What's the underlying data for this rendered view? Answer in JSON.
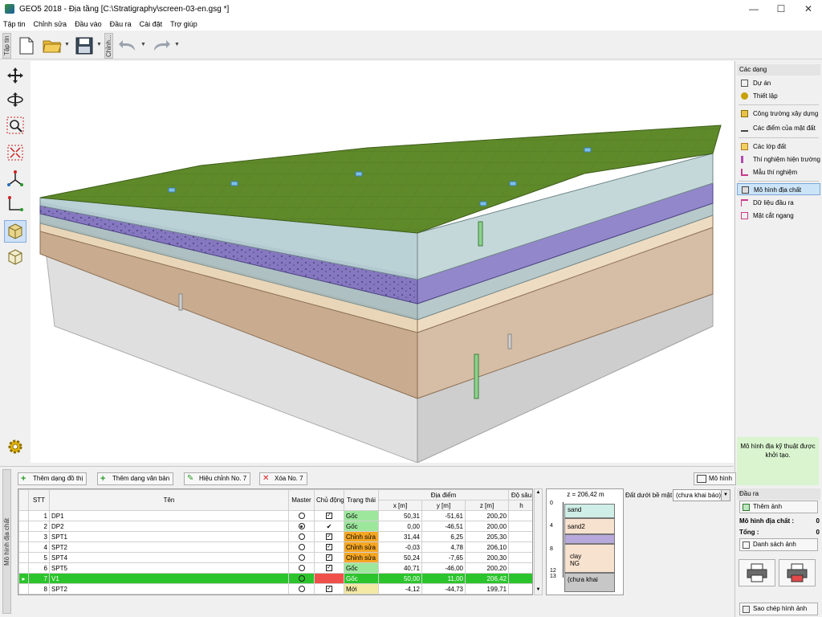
{
  "window": {
    "title": "GEO5 2018 - Địa tầng [C:\\Stratigraphy\\screen-03-en.gsg *]",
    "minimize": "—",
    "maximize": "☐",
    "close": "✕"
  },
  "menu": [
    "Tập tin",
    "Chỉnh sửa",
    "Đầu vào",
    "Đầu ra",
    "Cài đặt",
    "Trợ giúp"
  ],
  "toolbar": {
    "file_tab": "Tập tin",
    "edit_tab": "Chỉnh..."
  },
  "right_panel": {
    "header": "Các dạng",
    "items": [
      {
        "label": "Dự án",
        "icon": "project-icon",
        "color": "#555555"
      },
      {
        "label": "Thiết lập",
        "icon": "settings-gear-icon",
        "color": "#c8a000"
      },
      {
        "label": "Công trường xây dựng",
        "icon": "construction-site-icon",
        "color": "#8a6d00"
      },
      {
        "label": "Các điểm của mặt đất",
        "icon": "terrain-points-icon",
        "color": "#444444"
      },
      {
        "label": "Các lớp đất",
        "icon": "soil-layers-icon",
        "color": "#b07b1c"
      },
      {
        "label": "Thí nghiệm hiện trường",
        "icon": "field-test-icon",
        "color": "#b04cb0"
      },
      {
        "label": "Mẫu thí nghiệm",
        "icon": "lab-sample-icon",
        "color": "#cc3a8a"
      },
      {
        "label": "Mô hình địa chất",
        "icon": "geological-model-icon",
        "color": "#444444"
      },
      {
        "label": "Dữ liệu đầu ra",
        "icon": "output-data-icon",
        "color": "#cc3a8a"
      },
      {
        "label": "Mặt cắt ngang",
        "icon": "cross-section-icon",
        "color": "#cc3a8a"
      }
    ],
    "status_message": "Mô hình địa kỹ thuật được khởi tạo."
  },
  "output_panel": {
    "header": "Đầu ra",
    "add_image": "Thêm ảnh",
    "geo_model_label": "Mô hình địa chất :",
    "geo_model_count": "0",
    "total_label": "Tổng :",
    "total_count": "0",
    "image_list": "Danh sách ảnh",
    "copy_image": "Sao chép hình ảnh"
  },
  "bottom": {
    "side_label": "Mô hình địa chất",
    "buttons": {
      "add_graphic": "Thêm dạng đồ thị",
      "add_text": "Thêm dạng văn bản",
      "edit": "Hiệu chỉnh No. 7",
      "delete": "Xóa No. 7",
      "model": "Mô hình"
    },
    "soil_below_label": "Đất dưới bề mặt",
    "soil_below_value": "(chưa khai báo)",
    "table": {
      "headers": {
        "no": "STT",
        "name": "Tên",
        "master": "Master",
        "active": "Chủ động",
        "status": "Trạng thái",
        "location": "Địa điểm",
        "x": "x [m]",
        "y": "y [m]",
        "z": "z [m]",
        "depth": "Độ sâu",
        "depth_unit": "h"
      },
      "rows": [
        {
          "no": "1",
          "name": "DP1",
          "master": "off",
          "active": "check",
          "status": "Gốc",
          "st": "orig",
          "x": "50,31",
          "y": "-51,61",
          "z": "200,20"
        },
        {
          "no": "2",
          "name": "DP2",
          "master": "on",
          "active": "tick",
          "status": "Gốc",
          "st": "orig",
          "x": "0,00",
          "y": "-46,51",
          "z": "200,00"
        },
        {
          "no": "3",
          "name": "SPT1",
          "master": "off",
          "active": "check",
          "status": "Chỉnh sửa",
          "st": "edit",
          "x": "31,44",
          "y": "6,25",
          "z": "205,30"
        },
        {
          "no": "4",
          "name": "SPT2",
          "master": "off",
          "active": "check",
          "status": "Chỉnh sửa",
          "st": "edit",
          "x": "-0,03",
          "y": "4,78",
          "z": "206,10"
        },
        {
          "no": "5",
          "name": "SPT4",
          "master": "off",
          "active": "check",
          "status": "Chỉnh sửa",
          "st": "edit",
          "x": "50,24",
          "y": "-7,65",
          "z": "200,30"
        },
        {
          "no": "6",
          "name": "SPT5",
          "master": "off",
          "active": "check",
          "status": "Gốc",
          "st": "orig",
          "x": "40,71",
          "y": "-46,00",
          "z": "200,20"
        },
        {
          "no": "7",
          "name": "V1",
          "master": "off",
          "active": "red",
          "status": "Gốc",
          "st": "orig",
          "x": "50,00",
          "y": "11,00",
          "z": "206,42",
          "selected": true
        },
        {
          "no": "8",
          "name": "SPT2",
          "master": "off",
          "active": "check",
          "status": "Mới",
          "st": "new",
          "x": "-4,12",
          "y": "-44,73",
          "z": "199,71"
        }
      ]
    },
    "profile": {
      "title": "z = 206,42 m",
      "ticks": [
        "0",
        "4",
        "8",
        "12",
        "13"
      ],
      "layers": [
        {
          "label": "sand",
          "color": "#cfeee6"
        },
        {
          "label": "sand2",
          "color": "#f7e2cf"
        },
        {
          "label": "",
          "color": "#b7a9dc"
        },
        {
          "label": "clay",
          "color": "#f7e2cf"
        },
        {
          "label": "NG",
          "color": "#f7e2cf"
        },
        {
          "label": "(chưa khai",
          "color": "#c7c7c7"
        }
      ]
    }
  },
  "colors": {
    "selected_row": "#2cc42c",
    "status_original": "#9de79d",
    "status_edited": "#f5a623",
    "status_new": "#f3e9a4",
    "terrain": "#5f8a2a"
  }
}
